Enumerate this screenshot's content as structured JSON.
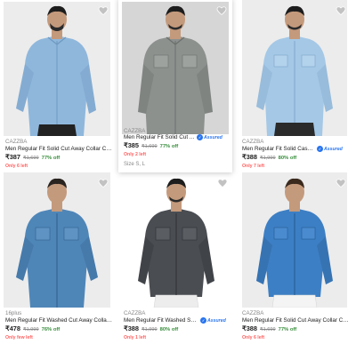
{
  "products": [
    {
      "brand": "CAZZBA",
      "title": "Men Regular Fit Solid Cut Away Collar Casual...",
      "price": "₹387",
      "mrp": "₹1,699",
      "discount": "77% off",
      "stock_note": "Only 6 left",
      "shirt_color": "#8fb7dc",
      "bg_color": "#ececec"
    },
    {
      "brand": "CAZZBA",
      "title": "Men Regular Fit Solid Cut Away ...",
      "price": "₹385",
      "mrp": "₹1,699",
      "discount": "77% off",
      "assured_label": "Assured",
      "stock_note": "Only 2 left",
      "size_label": "Size S, L",
      "shirt_color": "#8c918e",
      "bg_color": "#d6d6d6"
    },
    {
      "brand": "CAZZBA",
      "title": "Men Regular Fit Solid Casual Shirt",
      "price": "₹388",
      "mrp": "₹1,999",
      "discount": "80% off",
      "assured_label": "Assured",
      "stock_note": "Only 7 left",
      "shirt_color": "#a4c8e6",
      "bg_color": "#ececec"
    },
    {
      "brand": "16plus",
      "title": "Men Regular Fit Washed Cut Away Collar Casual...",
      "price": "₹478",
      "mrp": "₹1,999",
      "discount": "76% off",
      "stock_note": "Only few left",
      "shirt_color": "#4f86b8",
      "bg_color": "#ececec"
    },
    {
      "brand": "CAZZBA",
      "title": "Men Regular Fit Washed Spread ...",
      "price": "₹388",
      "mrp": "₹1,999",
      "discount": "80% off",
      "assured_label": "Assured",
      "stock_note": "Only 1 left",
      "shirt_color": "#4a4d52",
      "bg_color": "#ffffff"
    },
    {
      "brand": "CAZZBA",
      "title": "Men Regular Fit Solid Cut Away Collar Casual...",
      "price": "₹388",
      "mrp": "₹1,699",
      "discount": "77% off",
      "stock_note": "Only 6 left",
      "shirt_color": "#3d7fc4",
      "bg_color": "#ececec"
    }
  ],
  "colors": {
    "discount_green": "#388e3c",
    "stock_red": "#ff6161",
    "assured_blue": "#2874f0",
    "muted_gray": "#878787"
  },
  "icons": {
    "wishlist": "heart-icon",
    "assured": "assured-badge-icon"
  }
}
